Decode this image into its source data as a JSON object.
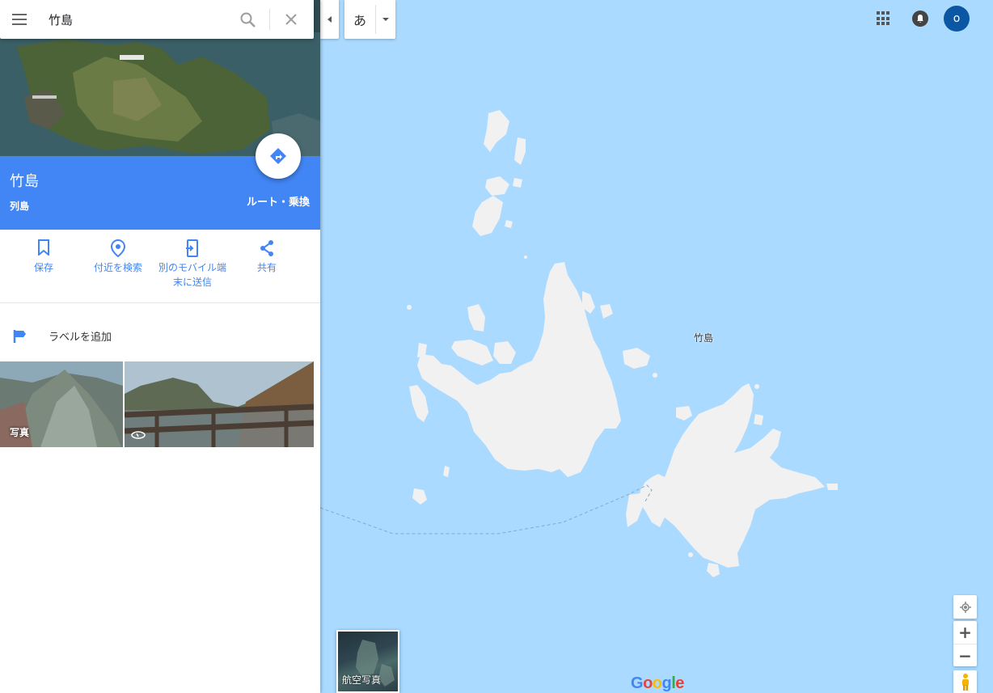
{
  "search": {
    "value": "竹島"
  },
  "place": {
    "title": "竹島",
    "category": "列島",
    "directions_label": "ルート・乗換"
  },
  "actions": [
    {
      "label": "保存",
      "icon": "bookmark-icon"
    },
    {
      "label": "付近を検索",
      "icon": "nearby-pin-icon"
    },
    {
      "label": "別のモバイル端末に送信",
      "icon": "send-to-device-icon"
    },
    {
      "label": "共有",
      "icon": "share-icon"
    }
  ],
  "label_row": {
    "text": "ラベルを追加",
    "icon": "flag-icon"
  },
  "photos": {
    "caption": "写真"
  },
  "ime": {
    "char": "あ"
  },
  "account": {
    "initial": "o"
  },
  "map": {
    "place_label": "竹島",
    "satellite_label": "航空写真",
    "logo": "Google"
  },
  "colors": {
    "accent": "#4285f4",
    "water": "#aadaff",
    "land": "#f1f1f1",
    "avatar": "#0b57a4"
  }
}
